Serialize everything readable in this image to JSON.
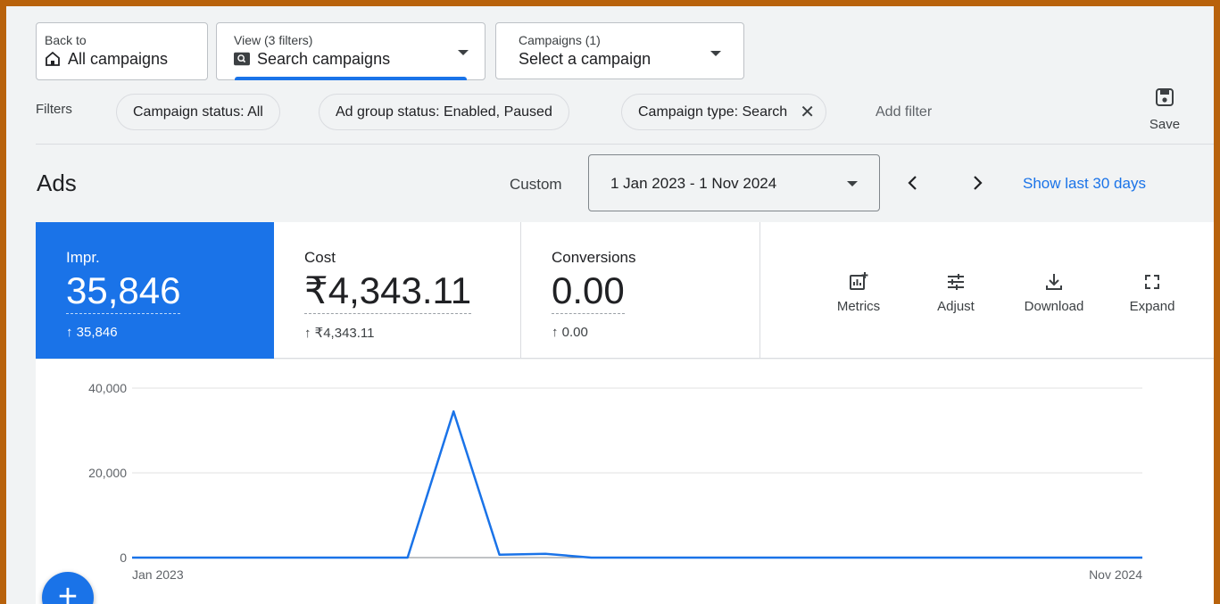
{
  "nav": {
    "back_small": "Back to",
    "back_big": "All campaigns",
    "view_small": "View (3 filters)",
    "view_big": "Search campaigns",
    "campaigns_small": "Campaigns (1)",
    "campaigns_big": "Select a campaign"
  },
  "filters": {
    "label": "Filters",
    "chips": [
      {
        "label": "Campaign status: All"
      },
      {
        "label": "Ad group status: Enabled, Paused"
      },
      {
        "label": "Campaign type: Search"
      }
    ],
    "add_filter": "Add filter",
    "save_label": "Save"
  },
  "ads": {
    "title": "Ads",
    "custom_label": "Custom",
    "date_range": "1 Jan 2023 - 1 Nov 2024",
    "show_last": "Show last 30 days"
  },
  "metrics": [
    {
      "name": "Impr.",
      "value": "35,846",
      "delta": "↑ 35,846"
    },
    {
      "name": "Cost",
      "value": "₹4,343.11",
      "delta": "↑ ₹4,343.11"
    },
    {
      "name": "Conversions",
      "value": "0.00",
      "delta": "↑ 0.00"
    }
  ],
  "tools": {
    "metrics": "Metrics",
    "adjust": "Adjust",
    "download": "Download",
    "expand": "Expand"
  },
  "colors": {
    "accent": "#1a73e8",
    "frame": "#b8620c"
  },
  "chart_data": {
    "type": "line",
    "x_labels": [
      "Jan 2023",
      "Nov 2024"
    ],
    "y_ticks": [
      "40,000",
      "20,000",
      "0"
    ],
    "ylim": [
      0,
      40000
    ],
    "series": [
      {
        "values": [
          0,
          0,
          0,
          0,
          0,
          0,
          0,
          34500,
          700,
          900,
          0,
          0,
          0,
          0,
          0,
          0,
          0,
          0,
          0,
          0,
          0,
          0,
          0
        ]
      }
    ]
  }
}
